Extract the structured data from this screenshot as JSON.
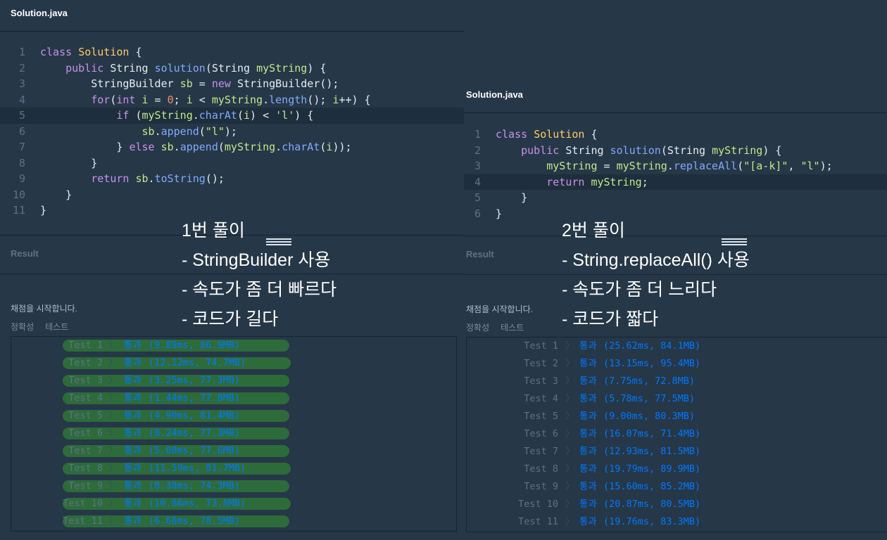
{
  "left": {
    "file_name": "Solution.java",
    "code_lines": [
      {
        "n": "1",
        "html": "<span class=\"kw\">class</span> <span class=\"cls\">Solution</span> {"
      },
      {
        "n": "2",
        "html": "    <span class=\"kw\">public</span> String <span class=\"fn\">solution</span>(String <span class=\"var\">myString</span>) {"
      },
      {
        "n": "3",
        "html": "        StringBuilder <span class=\"var\">sb</span> = <span class=\"kw\">new</span> StringBuilder();"
      },
      {
        "n": "4",
        "html": "        <span class=\"kw\">for</span>(<span class=\"kw\">int</span> <span class=\"var\">i</span> = <span class=\"num\">0</span>; <span class=\"var\">i</span> &lt; <span class=\"var\">myString</span>.<span class=\"fn\">length</span>(); <span class=\"var\">i</span>++) {"
      },
      {
        "n": "5",
        "html": "            <span class=\"kw\">if</span> (<span class=\"var\">myString</span>.<span class=\"fn\">charAt</span>(<span class=\"var\">i</span>) &lt; <span class=\"str\">'l'</span>) {"
      },
      {
        "n": "6",
        "html": "                <span class=\"var\">sb</span>.<span class=\"fn\">append</span>(<span class=\"str\">\"l\"</span>);"
      },
      {
        "n": "7",
        "html": "            } <span class=\"kw\">else</span> <span class=\"var\">sb</span>.<span class=\"fn\">append</span>(<span class=\"var\">myString</span>.<span class=\"fn\">charAt</span>(<span class=\"var\">i</span>));"
      },
      {
        "n": "8",
        "html": "        }"
      },
      {
        "n": "9",
        "html": "        <span class=\"kw\">return</span> <span class=\"var\">sb</span>.<span class=\"fn\">toString</span>();"
      },
      {
        "n": "10",
        "html": "    }"
      },
      {
        "n": "11",
        "html": "}"
      }
    ],
    "highlight_line": 5,
    "result_label": "Result",
    "status": "채점을 시작합니다.",
    "tabs": [
      "정확성",
      "테스트"
    ],
    "pass_label": "통과",
    "tests": [
      {
        "name": "Test 1",
        "detail": "(9.89ms, 86.9MB)"
      },
      {
        "name": "Test 2",
        "detail": "(12.12ms, 74.7MB)"
      },
      {
        "name": "Test 3",
        "detail": "(3.25ms, 77.3MB)"
      },
      {
        "name": "Test 4",
        "detail": "(1.44ms, 77.8MB)"
      },
      {
        "name": "Test 5",
        "detail": "(4.90ms, 81.4MB)"
      },
      {
        "name": "Test 6",
        "detail": "(8.24ms, 77.3MB)"
      },
      {
        "name": "Test 7",
        "detail": "(5.08ms, 77.6MB)"
      },
      {
        "name": "Test 8",
        "detail": "(11.59ms, 81.7MB)"
      },
      {
        "name": "Test 9",
        "detail": "(8.38ms, 74.3MB)"
      },
      {
        "name": "Test 10",
        "detail": "(10.86ms, 73.8MB)"
      },
      {
        "name": "Test 11",
        "detail": "(6.68ms, 78.5MB)"
      }
    ]
  },
  "right": {
    "file_name": "Solution.java",
    "code_lines": [
      {
        "n": "1",
        "html": "<span class=\"kw\">class</span> <span class=\"cls\">Solution</span> {"
      },
      {
        "n": "2",
        "html": "    <span class=\"kw\">public</span> String <span class=\"fn\">solution</span>(String <span class=\"var\">myString</span>) {"
      },
      {
        "n": "3",
        "html": "        <span class=\"var\">myString</span> = <span class=\"var\">myString</span>.<span class=\"fn\">replaceAll</span>(<span class=\"str\">\"[a-k]\"</span>, <span class=\"str\">\"l\"</span>);"
      },
      {
        "n": "4",
        "html": "        <span class=\"kw\">return</span> <span class=\"var\">myString</span>;"
      },
      {
        "n": "5",
        "html": "    }"
      },
      {
        "n": "6",
        "html": "}"
      }
    ],
    "highlight_line": 4,
    "result_label": "Result",
    "status": "채점을 시작합니다.",
    "tabs": [
      "정확성",
      "테스트"
    ],
    "pass_label": "통과",
    "tests": [
      {
        "name": "Test 1",
        "detail": "(25.62ms, 84.1MB)"
      },
      {
        "name": "Test 2",
        "detail": "(13.15ms, 95.4MB)"
      },
      {
        "name": "Test 3",
        "detail": "(7.75ms, 72.8MB)"
      },
      {
        "name": "Test 4",
        "detail": "(5.78ms, 77.5MB)"
      },
      {
        "name": "Test 5",
        "detail": "(9.00ms, 80.3MB)"
      },
      {
        "name": "Test 6",
        "detail": "(16.07ms, 71.4MB)"
      },
      {
        "name": "Test 7",
        "detail": "(12.93ms, 81.5MB)"
      },
      {
        "name": "Test 8",
        "detail": "(19.79ms, 89.9MB)"
      },
      {
        "name": "Test 9",
        "detail": "(15.60ms, 85.2MB)"
      },
      {
        "name": "Test 10",
        "detail": "(20.87ms, 80.5MB)"
      },
      {
        "name": "Test 11",
        "detail": "(19.76ms, 83.3MB)"
      }
    ]
  },
  "overlay_left": {
    "title": "1번 풀이",
    "points": [
      "- StringBuilder 사용",
      "- 속도가 좀 더 빠르다",
      "- 코드가 길다"
    ]
  },
  "overlay_right": {
    "title": "2번 풀이",
    "points": [
      "- String.replaceAll() 사용",
      "- 속도가 좀 더 느리다",
      "- 코드가 짧다"
    ]
  },
  "colors": {
    "background": "#263747",
    "pass_text": "#0078ff",
    "pass_highlight": "#2d6b3a"
  }
}
